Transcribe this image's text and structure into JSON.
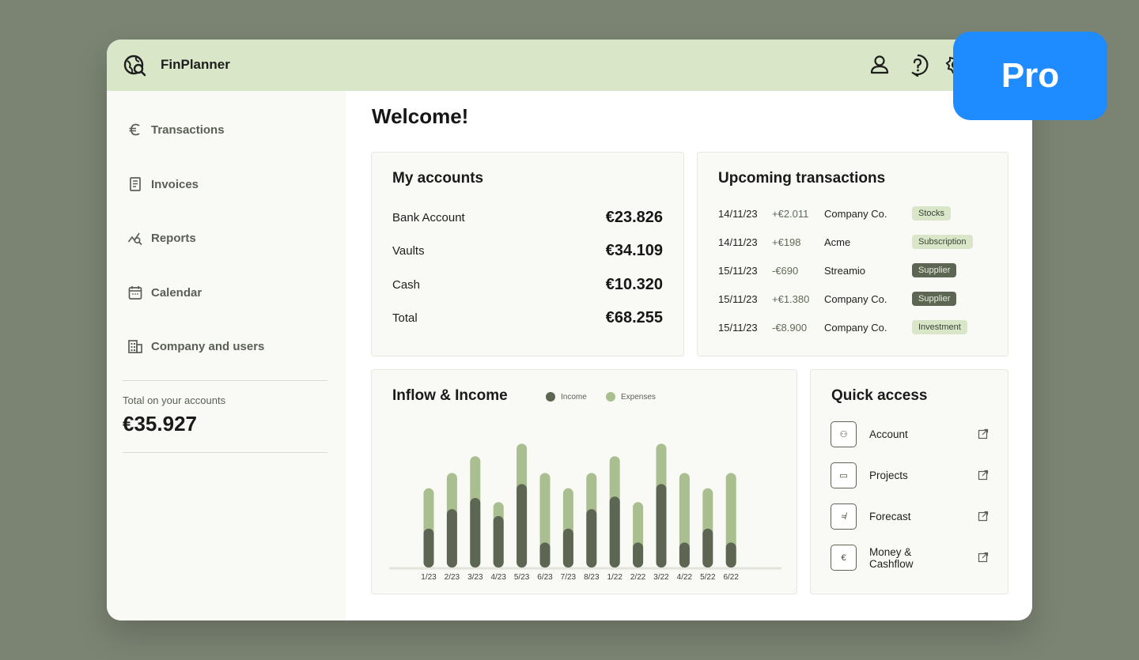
{
  "app": {
    "title": "FinPlanner"
  },
  "pro_badge": "Pro",
  "sidebar": {
    "items": [
      {
        "label": "Transactions",
        "icon": "euro-icon"
      },
      {
        "label": "Invoices",
        "icon": "invoice-icon"
      },
      {
        "label": "Reports",
        "icon": "reports-icon"
      },
      {
        "label": "Calendar",
        "icon": "calendar-icon"
      },
      {
        "label": "Company and users",
        "icon": "building-icon"
      }
    ],
    "total_label": "Total on your accounts",
    "total_value": "€35.927"
  },
  "main": {
    "welcome": "Welcome!"
  },
  "accounts": {
    "title": "My accounts",
    "rows": [
      {
        "name": "Bank Account",
        "amount": "€23.826"
      },
      {
        "name": "Vaults",
        "amount": "€34.109"
      },
      {
        "name": "Cash",
        "amount": "€10.320"
      },
      {
        "name": "Total",
        "amount": "€68.255"
      }
    ]
  },
  "upcoming": {
    "title": "Upcoming transactions",
    "rows": [
      {
        "date": "14/11/23",
        "amount": "+€2.011",
        "party": "Company Co.",
        "tag": "Stocks",
        "tag_style": "light"
      },
      {
        "date": "14/11/23",
        "amount": "+€198",
        "party": "Acme",
        "tag": "Subscription",
        "tag_style": "light"
      },
      {
        "date": "15/11/23",
        "amount": "-€690",
        "party": "Streamio",
        "tag": "Supplier",
        "tag_style": "dark"
      },
      {
        "date": "15/11/23",
        "amount": "+€1.380",
        "party": "Company Co.",
        "tag": "Supplier",
        "tag_style": "dark"
      },
      {
        "date": "15/11/23",
        "amount": "-€8.900",
        "party": "Company Co.",
        "tag": "Investment",
        "tag_style": "light"
      }
    ]
  },
  "chart_data": {
    "type": "bar",
    "title": "Inflow & Income",
    "categories": [
      "1/23",
      "2/23",
      "3/23",
      "4/23",
      "5/23",
      "6/23",
      "7/23",
      "8/23",
      "1/22",
      "2/22",
      "3/22",
      "4/22",
      "5/22",
      "6/22"
    ],
    "series": [
      {
        "name": "Income",
        "color": "#5d6553",
        "values": [
          28,
          42,
          50,
          37,
          60,
          18,
          28,
          42,
          51,
          18,
          60,
          18,
          28,
          18
        ]
      },
      {
        "name": "Expenses",
        "color": "#a9bf8f",
        "values": [
          57,
          68,
          80,
          47,
          89,
          68,
          57,
          68,
          80,
          47,
          89,
          68,
          57,
          68
        ]
      }
    ],
    "stacking": "overlay (Expenses drawn as full bar height, Income as inner portion)",
    "ylim": [
      0,
      100
    ],
    "grid": false,
    "legend": "top"
  },
  "quick_access": {
    "title": "Quick access",
    "items": [
      {
        "label": "Account",
        "icon": "account-icon",
        "glyph": "⚇"
      },
      {
        "label": "Projects",
        "icon": "folder-icon",
        "glyph": "▭"
      },
      {
        "label": "Forecast",
        "icon": "forecast-icon",
        "glyph": "≉"
      },
      {
        "label": "Money & Cashflow",
        "label_line1": "Money &",
        "label_line2": "Cashflow",
        "icon": "euro-icon",
        "glyph": "€"
      }
    ]
  },
  "colors": {
    "accent_light": "#d9e6c8",
    "accent_dark": "#5d6553",
    "background": "#7b8473",
    "pro_blue": "#1e8bff"
  }
}
